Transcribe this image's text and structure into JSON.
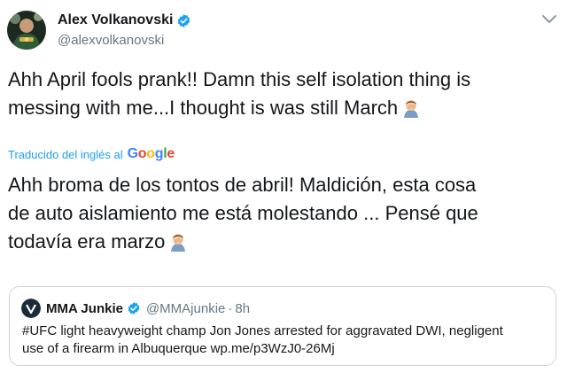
{
  "author": {
    "display_name": "Alex Volkanovski",
    "handle": "@alexvolkanovski",
    "verified": true
  },
  "tweet": {
    "line1": "Ahh April fools prank!! Damn this self isolation thing is",
    "line2": "messing with me...I thought is was still March",
    "emoji": "man-facepalming"
  },
  "translation": {
    "label": "Traducido del inglés al",
    "provider": "Google",
    "line1": "Ahh broma de los tontos de abril! Maldición, esta cosa",
    "line2": "de auto aislamiento me está molestando ... Pensé que",
    "line3": "todavía era marzo"
  },
  "quoted_tweet": {
    "display_name": "MMA Junkie",
    "handle": "@MMAjunkie",
    "separator": "·",
    "time": "8h",
    "line1": "#UFC light heavyweight champ Jon Jones arrested for aggravated DWI, negligent",
    "line2": "use of a firearm in Albuquerque wp.me/p3WzJ0-26Mj"
  },
  "colors": {
    "link_blue": "#1da1f2",
    "text": "#14171a",
    "secondary": "#657786",
    "border": "#ccd6dd"
  }
}
